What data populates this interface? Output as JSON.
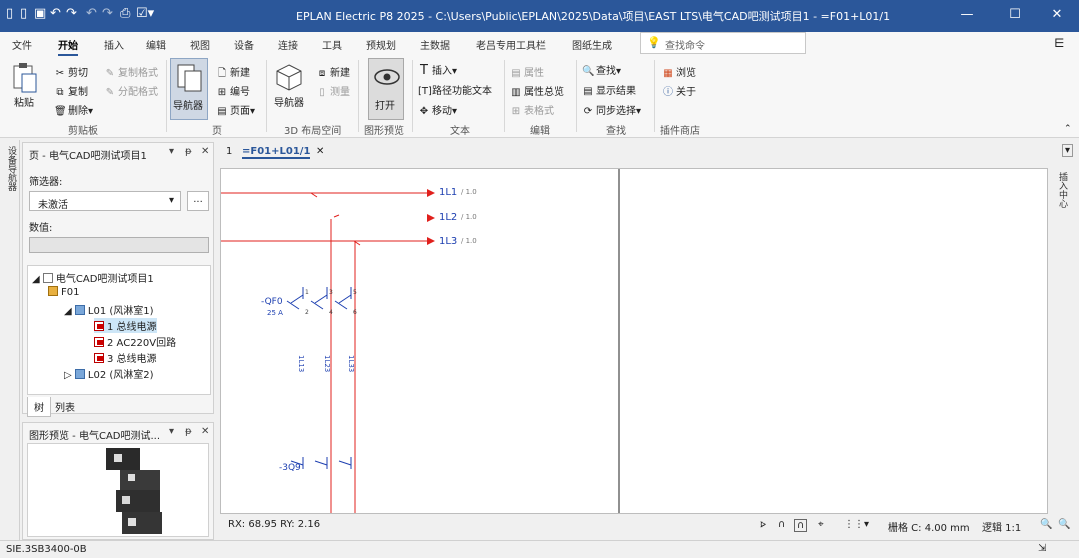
{
  "window": {
    "title": "EPLAN Electric P8 2025 - C:\\Users\\Public\\EPLAN\\2025\\Data\\项目\\EAST LTS\\电气CAD吧测试项目1 - =F01+L01/1",
    "min": "—",
    "max": "☐",
    "close": "✕"
  },
  "menu": {
    "tabs": [
      "文件",
      "开始",
      "插入",
      "编辑",
      "视图",
      "设备",
      "连接",
      "工具",
      "预规划",
      "主数据",
      "老吕专用工具栏",
      "图纸生成"
    ],
    "search_placeholder": "查找命令"
  },
  "ribbon": {
    "clipboard": {
      "paste": "粘贴",
      "cut": "剪切",
      "copy": "复制",
      "delete": "删除",
      "copy_format": "复制格式",
      "assign_format": "分配格式",
      "label": "剪贴板"
    },
    "page": {
      "navigator": "导航器",
      "new": "新建",
      "number": "编号",
      "open": "页面",
      "label": "页"
    },
    "layout3d": {
      "navigator": "导航器",
      "new": "新建",
      "measure": "测量",
      "label": "3D 布局空间"
    },
    "preview": {
      "open": "打开",
      "label": "图形预览"
    },
    "text": {
      "insert": "插入",
      "path_func": "路径功能文本",
      "move": "移动",
      "label": "文本"
    },
    "edit": {
      "properties": "属性",
      "prop_overview": "属性总览",
      "table_format": "表格式",
      "label": "编辑"
    },
    "find": {
      "find": "查找",
      "show_results": "显示结果",
      "sync_select": "同步选择",
      "label": "查找"
    },
    "store": {
      "browse": "浏览",
      "about": "关于",
      "label": "插件商店"
    }
  },
  "left_strip_label": "设备导航器",
  "nav_panel": {
    "title": "页 - 电气CAD吧测试项目1",
    "filter_label": "筛选器:",
    "filter_value": "未激活",
    "filter_btn": "...",
    "value_label": "数值:",
    "tree": {
      "root": "电气CAD吧测试项目1",
      "f01": "F01",
      "l01": "L01 (风淋室1)",
      "p1": "1 总线电源",
      "p2": "2 AC220V回路",
      "p3": "3 总线电源",
      "l02": "L02 (风淋室2)"
    },
    "tabs": [
      "树",
      "列表"
    ]
  },
  "preview_panel": {
    "title": "图形预览 - 电气CAD吧测试..."
  },
  "doc_tabs": {
    "num": "1",
    "active": "=F01+L01/1",
    "close": "✕"
  },
  "schematic": {
    "labels": {
      "l1": "1L1",
      "l2": "1L2",
      "l3": "1L3",
      "ref": "/ 1.0",
      "qf": "-QF0",
      "qf_rating": "25 A",
      "w1": "1L13",
      "w2": "1L23",
      "w3": "1L33",
      "k": "-3Q9"
    },
    "pins": {
      "p1": "1",
      "p2": "3",
      "p3": "5",
      "p4": "2",
      "p5": "4",
      "p6": "6"
    },
    "colors": {
      "wire": "#e0201c",
      "text": "#1d3fb0",
      "sym": "#1d3fb0"
    }
  },
  "right_strip_label": "插入中心",
  "coord": {
    "position": "RX: 68.95 RY: 2.16",
    "grid": "栅格 C: 4.00 mm",
    "scale": "逻辑 1:1"
  },
  "status": {
    "left": "SIE.3SB3400-0B"
  }
}
